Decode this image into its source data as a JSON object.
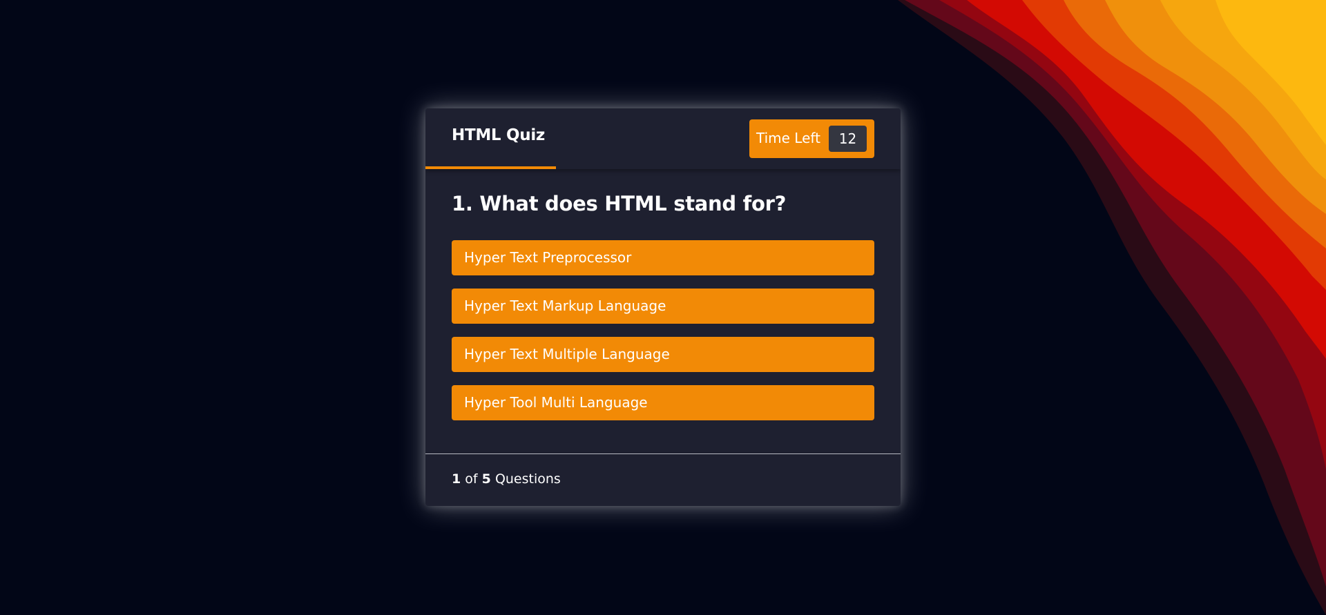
{
  "quiz": {
    "title": "HTML Quiz",
    "timer_label": "Time Left",
    "timer_value": "12"
  },
  "question": {
    "text": "1. What does HTML stand for?",
    "options": [
      "Hyper Text Preprocessor",
      "Hyper Text Markup Language",
      "Hyper Text Multiple Language",
      "Hyper Tool Multi Language"
    ]
  },
  "footer": {
    "current": "1",
    "of_label": "of",
    "total": "5",
    "questions_label": "Questions"
  },
  "colors": {
    "background": "#020617",
    "card": "#1e2030",
    "accent": "#f28a06",
    "timer_value_bg": "#343640",
    "text": "#ffffff"
  }
}
